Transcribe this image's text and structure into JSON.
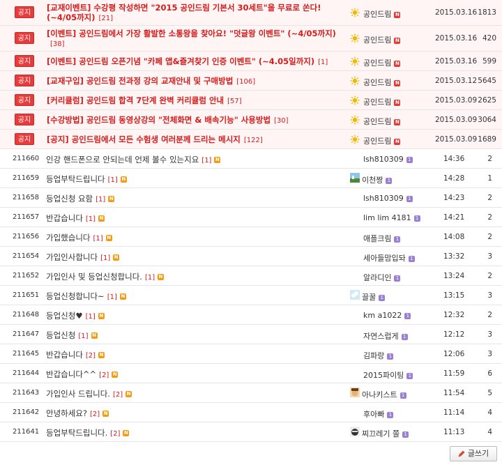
{
  "notices": [
    {
      "badge": "공지",
      "title": "[교재이벤트] 수강평 작성하면 \"2015 공인드림 기본서 30세트\"을 무료로 쏜다! (~4/05까지)",
      "count": "[21]",
      "author": "공인드림",
      "date": "2015.03.16",
      "views": "1813",
      "tall": true
    },
    {
      "badge": "공지",
      "title": "[이벤트] 공인드림에서 가장 활발한 소통왕을 찾아요! \"덧글왕 이벤트\" (~4/05까지)",
      "count": "[38]",
      "author": "공인드림",
      "date": "2015.03.16",
      "views": "420",
      "tall": true
    },
    {
      "badge": "공지",
      "title": "[이벤트] 공인드림 오픈기념 \"카페 앱&즐겨찾기 인증 이벤트\" (~4.05일까지)",
      "count": "[1]",
      "author": "공인드림",
      "date": "2015.03.16",
      "views": "599",
      "tall": false
    },
    {
      "badge": "공지",
      "title": "[교재구입] 공인드림 전과정 강의 교재안내 및 구매방법",
      "count": "[106]",
      "author": "공인드림",
      "date": "2015.03.12",
      "views": "5645",
      "tall": false
    },
    {
      "badge": "공지",
      "title": "[커리큘럼] 공인드림 합격 7단계 완벽 커리큘럼 안내",
      "count": "[57]",
      "author": "공인드림",
      "date": "2015.03.09",
      "views": "2625",
      "tall": false
    },
    {
      "badge": "공지",
      "title": "[수강방법] 공인드림 동영상강의 \"전체화면 & 배속기능\" 사용방법",
      "count": "[30]",
      "author": "공인드림",
      "date": "2015.03.09",
      "views": "3064",
      "tall": false
    },
    {
      "badge": "공지",
      "title": "[공지] 공인드림에서 모든 수험생 여러분께 드리는 메시지",
      "count": "[122]",
      "author": "공인드림",
      "date": "2015.03.09",
      "views": "1689",
      "tall": false
    }
  ],
  "posts": [
    {
      "num": "211660",
      "title": "인강 핸드폰으로 안되는데 언제 볼수 있는지요",
      "cmt": "[1]",
      "author": "lsh810309",
      "avatar": "",
      "time": "14:36",
      "views": "2"
    },
    {
      "num": "211659",
      "title": "등업부탁드립니다",
      "cmt": "[1]",
      "author": "이천짱",
      "avatar": "landscape",
      "time": "14:28",
      "views": "1"
    },
    {
      "num": "211658",
      "title": "등업신청 요함",
      "cmt": "[1]",
      "author": "lsh810309",
      "avatar": "",
      "time": "14:23",
      "views": "2"
    },
    {
      "num": "211657",
      "title": "반갑습니다",
      "cmt": "[1]",
      "author": "lim lim 4181",
      "avatar": "",
      "time": "14:21",
      "views": "2"
    },
    {
      "num": "211656",
      "title": "가입했습니다",
      "cmt": "[1]",
      "author": "애플크림",
      "avatar": "",
      "time": "14:08",
      "views": "2"
    },
    {
      "num": "211654",
      "title": "가입인사합니다",
      "cmt": "[1]",
      "author": "세아들맘입돠",
      "avatar": "",
      "time": "13:32",
      "views": "3"
    },
    {
      "num": "211652",
      "title": "가입인사 및 등업신청합니다.",
      "cmt": "[1]",
      "author": "알라디인",
      "avatar": "",
      "time": "13:24",
      "views": "2"
    },
    {
      "num": "211651",
      "title": "등업신청합니다~",
      "cmt": "[1]",
      "author": "끌꿀",
      "avatar": "sky",
      "time": "13:15",
      "views": "3"
    },
    {
      "num": "211648",
      "title": "등업신청♥",
      "cmt": "[1]",
      "author": "km a1022",
      "avatar": "",
      "time": "12:32",
      "views": "2"
    },
    {
      "num": "211647",
      "title": "등업신청",
      "cmt": "[1]",
      "author": "자연스럽게",
      "avatar": "",
      "time": "12:12",
      "views": "3"
    },
    {
      "num": "211645",
      "title": "반갑습니다",
      "cmt": "[2]",
      "author": "김파랑",
      "avatar": "",
      "time": "12:06",
      "views": "3"
    },
    {
      "num": "211644",
      "title": "반갑습니다^^",
      "cmt": "[2]",
      "author": "2015파이팅",
      "avatar": "",
      "time": "11:59",
      "views": "6"
    },
    {
      "num": "211643",
      "title": "가입인사 드립니다.",
      "cmt": "[2]",
      "author": "아나키스트",
      "avatar": "face",
      "time": "11:54",
      "views": "5"
    },
    {
      "num": "211642",
      "title": "안녕하세요?",
      "cmt": "[2]",
      "author": "후아빠",
      "avatar": "",
      "time": "11:14",
      "views": "4"
    },
    {
      "num": "211641",
      "title": "등업부탁드립니다.",
      "cmt": "[2]",
      "author": "찌끄레기 쫄",
      "avatar": "dark",
      "time": "11:13",
      "views": "4"
    }
  ],
  "icons": {
    "new": "N",
    "level": "1"
  },
  "write_button": {
    "label": "글쓰기"
  },
  "colors": {
    "notice_red": "#d81b1b",
    "badge_red": "#e83c3c"
  }
}
